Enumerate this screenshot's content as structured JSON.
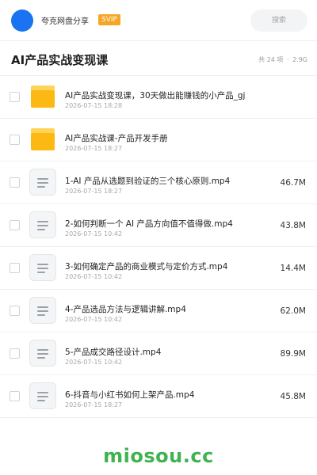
{
  "header": {
    "owner": "夸克网盘分享",
    "badge": "SVIP",
    "search_placeholder": "搜索"
  },
  "folder": {
    "title": "AI产品实战变现课",
    "item_count": "共 24 项",
    "separator": "·",
    "total_size": "2.9G"
  },
  "files": [
    {
      "type": "folder",
      "icon": "folder-icon",
      "name": "AI产品实战变现课，30天做出能赚钱的小产品_gj",
      "date": "2026-07-15 18:28",
      "size": ""
    },
    {
      "type": "folder",
      "icon": "folder-icon",
      "name": "AI产品实战课-产品开发手册",
      "date": "2026-07-15 18:27",
      "size": ""
    },
    {
      "type": "video",
      "icon": "video-file-icon",
      "name": "1-AI 产品从选题到验证的三个核心原则.mp4",
      "date": "2026-07-15 18:27",
      "size": "46.7M"
    },
    {
      "type": "video",
      "icon": "video-file-icon",
      "name": "2-如何判断一个 AI 产品方向值不值得做.mp4",
      "date": "2026-07-15 10:42",
      "size": "43.8M"
    },
    {
      "type": "video",
      "icon": "video-file-icon",
      "name": "3-如何确定产品的商业模式与定价方式.mp4",
      "date": "2026-07-15 10:42",
      "size": "14.4M"
    },
    {
      "type": "video",
      "icon": "video-file-icon",
      "name": "4-产品选品方法与逻辑讲解.mp4",
      "date": "2026-07-15 10:42",
      "size": "62.0M"
    },
    {
      "type": "video",
      "icon": "video-file-icon",
      "name": "5-产品成交路径设计.mp4",
      "date": "2026-07-15 10:42",
      "size": "89.9M"
    },
    {
      "type": "video",
      "icon": "video-file-icon",
      "name": "6-抖音与小红书如何上架产品.mp4",
      "date": "2026-07-15 18:27",
      "size": "45.8M"
    }
  ],
  "watermark": "miosou.cc",
  "colors": {
    "accent_blue": "#1a73f0",
    "svip_orange": "#f5a623",
    "folder_yellow": "#fdb913",
    "watermark_green": "#3fb34f"
  }
}
